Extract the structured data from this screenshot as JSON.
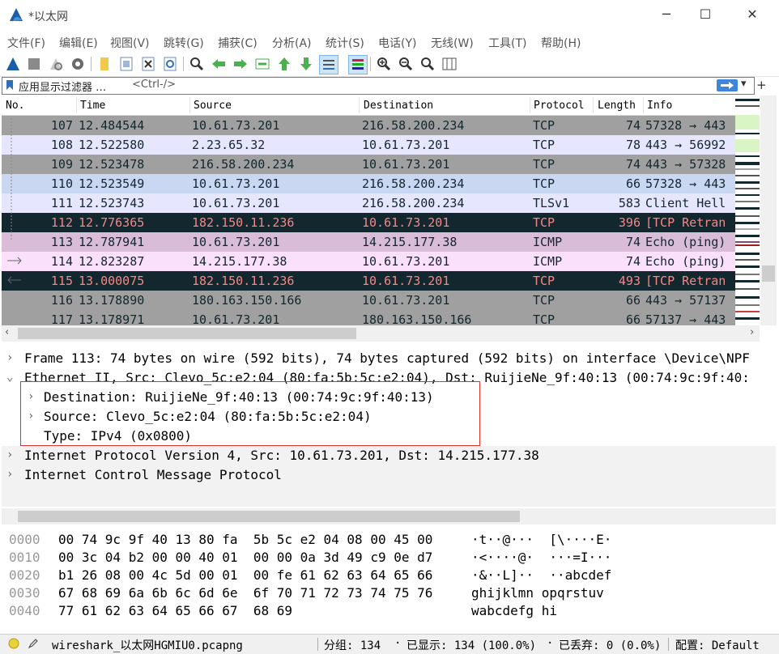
{
  "window": {
    "title": "*以太网"
  },
  "menu": [
    "文件(F)",
    "编辑(E)",
    "视图(V)",
    "跳转(G)",
    "捕获(C)",
    "分析(A)",
    "统计(S)",
    "电话(Y)",
    "无线(W)",
    "工具(T)",
    "帮助(H)"
  ],
  "filter": {
    "label": "应用显示过滤器 …",
    "placeholder": "<Ctrl-/>"
  },
  "columns": {
    "no": "No.",
    "time": "Time",
    "source": "Source",
    "destination": "Destination",
    "protocol": "Protocol",
    "length": "Length",
    "info": "Info"
  },
  "packets": [
    {
      "no": "107",
      "time": "12.484544",
      "src": "10.61.73.201",
      "dst": "216.58.200.234",
      "proto": "TCP",
      "len": "74",
      "info": "57328 → 443",
      "bg": "#a0a0a0",
      "fg": "#12272e"
    },
    {
      "no": "108",
      "time": "12.522580",
      "src": "2.23.65.32",
      "dst": "10.61.73.201",
      "proto": "TCP",
      "len": "78",
      "info": "443 → 56992",
      "bg": "#e7e6ff",
      "fg": "#12272e"
    },
    {
      "no": "109",
      "time": "12.523478",
      "src": "216.58.200.234",
      "dst": "10.61.73.201",
      "proto": "TCP",
      "len": "74",
      "info": "443 → 57328",
      "bg": "#a0a0a0",
      "fg": "#12272e"
    },
    {
      "no": "110",
      "time": "12.523549",
      "src": "10.61.73.201",
      "dst": "216.58.200.234",
      "proto": "TCP",
      "len": "66",
      "info": "57328 → 443",
      "bg": "#c9d7f2",
      "fg": "#12272e"
    },
    {
      "no": "111",
      "time": "12.523743",
      "src": "10.61.73.201",
      "dst": "216.58.200.234",
      "proto": "TLSv1",
      "len": "583",
      "info": "Client Hell",
      "bg": "#e7e6ff",
      "fg": "#12272e"
    },
    {
      "no": "112",
      "time": "12.776365",
      "src": "182.150.11.236",
      "dst": "10.61.73.201",
      "proto": "TCP",
      "len": "396",
      "info": "[TCP Retran",
      "bg": "#12272e",
      "fg": "#f78787"
    },
    {
      "no": "113",
      "time": "12.787941",
      "src": "10.61.73.201",
      "dst": "14.215.177.38",
      "proto": "ICMP",
      "len": "74",
      "info": "Echo (ping)",
      "bg": "#d8bcd8",
      "fg": "#12272e"
    },
    {
      "no": "114",
      "time": "12.823287",
      "src": "14.215.177.38",
      "dst": "10.61.73.201",
      "proto": "ICMP",
      "len": "74",
      "info": "Echo (ping)",
      "bg": "#fbe0fb",
      "fg": "#12272e"
    },
    {
      "no": "115",
      "time": "13.000075",
      "src": "182.150.11.236",
      "dst": "10.61.73.201",
      "proto": "TCP",
      "len": "493",
      "info": "[TCP Retran",
      "bg": "#12272e",
      "fg": "#f78787"
    },
    {
      "no": "116",
      "time": "13.178890",
      "src": "180.163.150.166",
      "dst": "10.61.73.201",
      "proto": "TCP",
      "len": "66",
      "info": "443 → 57137",
      "bg": "#a0a0a0",
      "fg": "#12272e"
    },
    {
      "no": "117",
      "time": "13.178971",
      "src": "10.61.73.201",
      "dst": "180.163.150.166",
      "proto": "TCP",
      "len": "66",
      "info": "57137 → 443",
      "bg": "#a0a0a0",
      "fg": "#12272e"
    }
  ],
  "details": {
    "frame": "Frame 113: 74 bytes on wire (592 bits), 74 bytes captured (592 bits) on interface \\Device\\NPF",
    "ethernet": "Ethernet II, Src: Clevo_5c:e2:04 (80:fa:5b:5c:e2:04), Dst: RuijieNe_9f:40:13 (00:74:9c:9f:40:",
    "eth_dst": "Destination: RuijieNe_9f:40:13 (00:74:9c:9f:40:13)",
    "eth_src": "Source: Clevo_5c:e2:04 (80:fa:5b:5c:e2:04)",
    "eth_type": "Type: IPv4 (0x0800)",
    "ip": "Internet Protocol Version 4, Src: 10.61.73.201, Dst: 14.215.177.38",
    "icmp": "Internet Control Message Protocol"
  },
  "bytes": [
    {
      "off": "0000",
      "hex": "00 74 9c 9f 40 13 80 fa  5b 5c e2 04 08 00 45 00",
      "ascii": "·t··@···  [\\····E·"
    },
    {
      "off": "0010",
      "hex": "00 3c 04 b2 00 00 40 01  00 00 0a 3d 49 c9 0e d7",
      "ascii": "·<····@·  ···=I···"
    },
    {
      "off": "0020",
      "hex": "b1 26 08 00 4c 5d 00 01  00 fe 61 62 63 64 65 66",
      "ascii": "·&··L]··  ··abcdef"
    },
    {
      "off": "0030",
      "hex": "67 68 69 6a 6b 6c 6d 6e  6f 70 71 72 73 74 75 76",
      "ascii": "ghijklmn opqrstuv"
    },
    {
      "off": "0040",
      "hex": "77 61 62 63 64 65 66 67  68 69",
      "ascii": "wabcdefg hi"
    }
  ],
  "status": {
    "file": "wireshark_以太网HGMIU0.pcapng",
    "packets": "分组: 134",
    "displayed": "已显示: 134 (100.0%)",
    "dropped": "已丢弃: 0 (0.0%)",
    "profile": "配置: Default"
  },
  "colors": {
    "selection_box": "#e03030",
    "status_dot": "#e8d23a"
  }
}
